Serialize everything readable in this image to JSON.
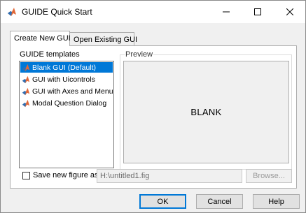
{
  "window": {
    "title": "GUIDE Quick Start",
    "icon": "matlab-logo-icon"
  },
  "tabs": [
    {
      "label": "Create New GUI",
      "active": true
    },
    {
      "label": "Open Existing GUI",
      "active": false
    }
  ],
  "templates": {
    "group_label": "GUIDE templates",
    "items": [
      {
        "label": "Blank GUI (Default)",
        "selected": true
      },
      {
        "label": "GUI with Uicontrols",
        "selected": false
      },
      {
        "label": "GUI with Axes and Menu",
        "selected": false
      },
      {
        "label": "Modal Question Dialog",
        "selected": false
      }
    ]
  },
  "preview": {
    "group_label": "Preview",
    "text": "BLANK"
  },
  "save": {
    "checkbox_label": "Save new figure as:",
    "checked": false,
    "path_value": "H:\\untitled1.fig",
    "browse_label": "Browse..."
  },
  "buttons": {
    "ok": "OK",
    "cancel": "Cancel",
    "help": "Help"
  },
  "colors": {
    "selection": "#0078d7",
    "matlab_orange": "#e16737"
  }
}
